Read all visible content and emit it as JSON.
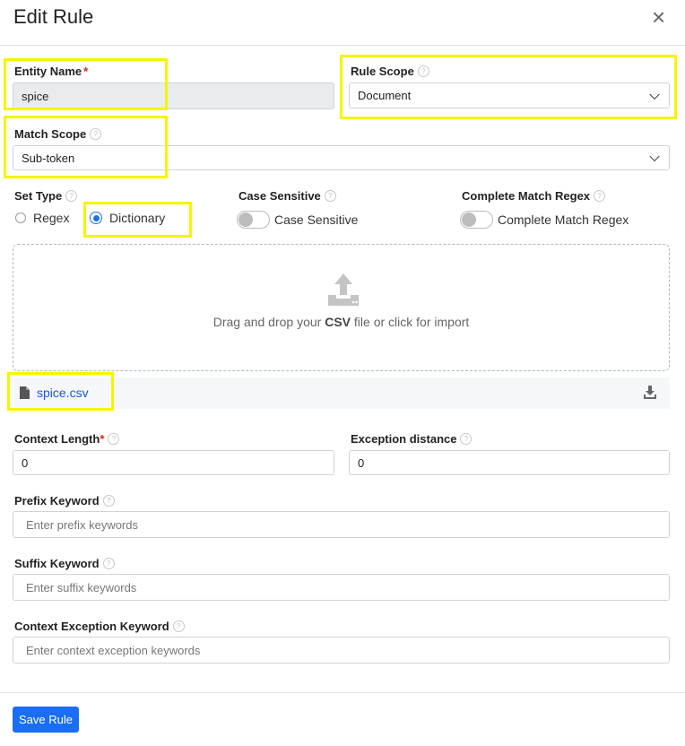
{
  "dialog": {
    "title": "Edit Rule",
    "close_glyph": "×"
  },
  "entity_name": {
    "label": "Entity Name",
    "required": "*",
    "value": "spice"
  },
  "rule_scope": {
    "label": "Rule Scope",
    "value": "Document"
  },
  "match_scope": {
    "label": "Match Scope",
    "value": "Sub-token"
  },
  "set_type": {
    "label": "Set Type",
    "options": [
      {
        "label": "Regex",
        "selected": false
      },
      {
        "label": "Dictionary",
        "selected": true
      }
    ]
  },
  "case_sensitive": {
    "label": "Case Sensitive",
    "toggle_label": "Case Sensitive",
    "on": false
  },
  "complete_match_regex": {
    "label": "Complete Match Regex",
    "toggle_label": "Complete Match Regex",
    "on": false
  },
  "dropzone": {
    "text_before": "Drag and drop your ",
    "text_bold": "CSV",
    "text_after": " file or click for import"
  },
  "file": {
    "name": "spice.csv",
    "icon_text": "CSV"
  },
  "context_length": {
    "label": "Context Length",
    "required": "*",
    "value": "0"
  },
  "exception_distance": {
    "label": "Exception distance",
    "value": "0"
  },
  "prefix_keyword": {
    "label": "Prefix Keyword",
    "placeholder": "Enter prefix keywords"
  },
  "suffix_keyword": {
    "label": "Suffix Keyword",
    "placeholder": "Enter suffix keywords"
  },
  "context_exception_keyword": {
    "label": "Context Exception Keyword",
    "placeholder": "Enter context exception keywords"
  },
  "footer": {
    "save_label": "Save Rule"
  },
  "help_glyph": "?",
  "colors": {
    "accent": "#1a6ef5",
    "highlight": "#f5f500",
    "required": "#e02424",
    "link": "#1a56db"
  }
}
